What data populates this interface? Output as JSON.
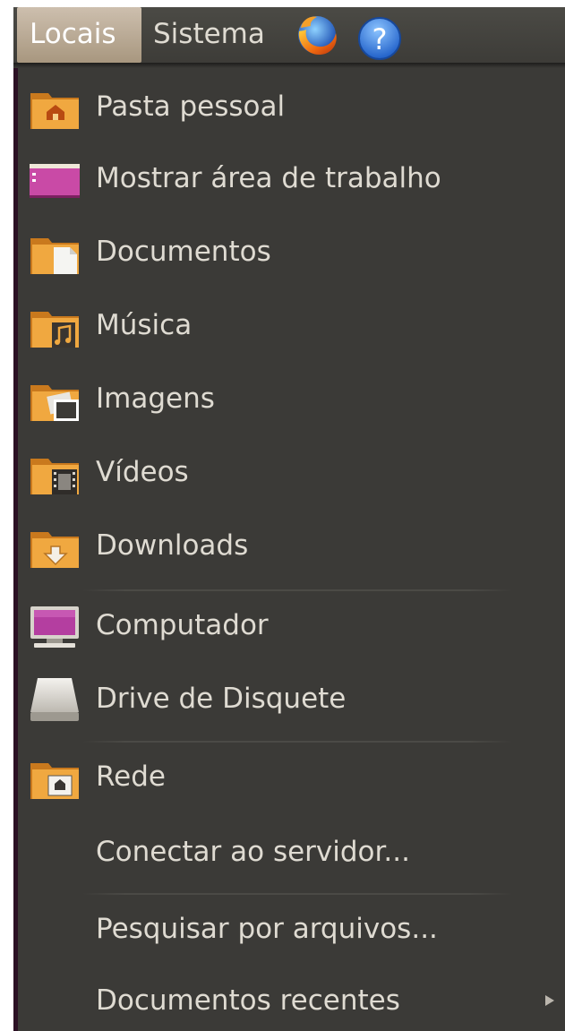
{
  "panel": {
    "menus": [
      "Locais",
      "Sistema"
    ],
    "launchers": [
      "firefox-icon",
      "help-icon"
    ],
    "help_glyph": "?"
  },
  "menu": {
    "items": [
      {
        "label": "Pasta pessoal",
        "icon": "home-folder-icon"
      },
      {
        "label": "Mostrar área de trabalho",
        "icon": "desktop-icon"
      },
      {
        "label": "Documentos",
        "icon": "documents-folder-icon"
      },
      {
        "label": "Música",
        "icon": "music-folder-icon"
      },
      {
        "label": "Imagens",
        "icon": "pictures-folder-icon"
      },
      {
        "label": "Vídeos",
        "icon": "videos-folder-icon"
      },
      {
        "label": "Downloads",
        "icon": "downloads-folder-icon"
      },
      {
        "label": "Computador",
        "icon": "computer-icon"
      },
      {
        "label": "Drive de Disquete",
        "icon": "floppy-drive-icon"
      },
      {
        "label": "Rede",
        "icon": "network-folder-icon"
      },
      {
        "label": "Conectar ao servidor...",
        "icon": ""
      },
      {
        "label": "Pesquisar por arquivos...",
        "icon": ""
      },
      {
        "label": "Documentos recentes",
        "icon": "submenu-arrow-icon"
      }
    ]
  },
  "colors": {
    "menu_bg": "#3b3a37",
    "text": "#dfdbd2",
    "selected_menu": "#b9a891",
    "folder": "#e59b3a"
  }
}
